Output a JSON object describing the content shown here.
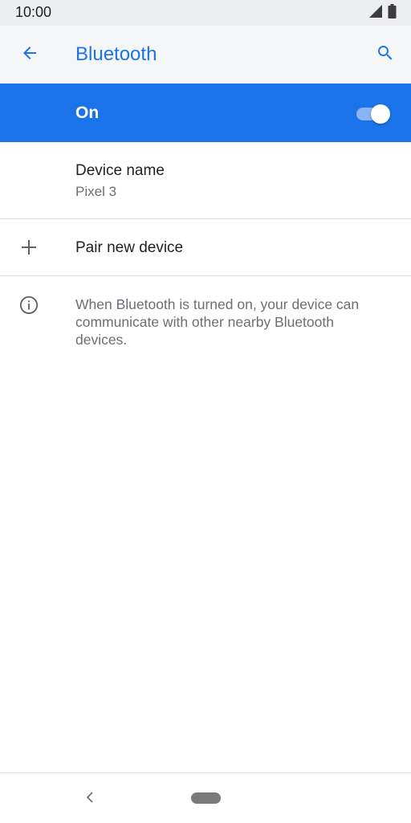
{
  "status_bar": {
    "time": "10:00",
    "icons": [
      "signal-icon",
      "battery-icon"
    ]
  },
  "app_bar": {
    "title": "Bluetooth",
    "back_icon": "arrow-back-icon",
    "search_icon": "search-icon",
    "accent_color": "#1a73e8"
  },
  "bluetooth_toggle": {
    "label": "On",
    "state": "on",
    "background_color": "#1a73e8"
  },
  "settings": {
    "device_name": {
      "title": "Device name",
      "value": "Pixel 3"
    },
    "pair_new_device": {
      "title": "Pair new device",
      "icon": "plus-icon"
    },
    "info": {
      "icon": "info-icon",
      "text": "When Bluetooth is turned on, your device can communicate with other nearby Bluetooth devices."
    }
  },
  "nav_bar": {
    "back_icon": "nav-back-chevron-icon",
    "home_icon": "home-pill-icon"
  }
}
